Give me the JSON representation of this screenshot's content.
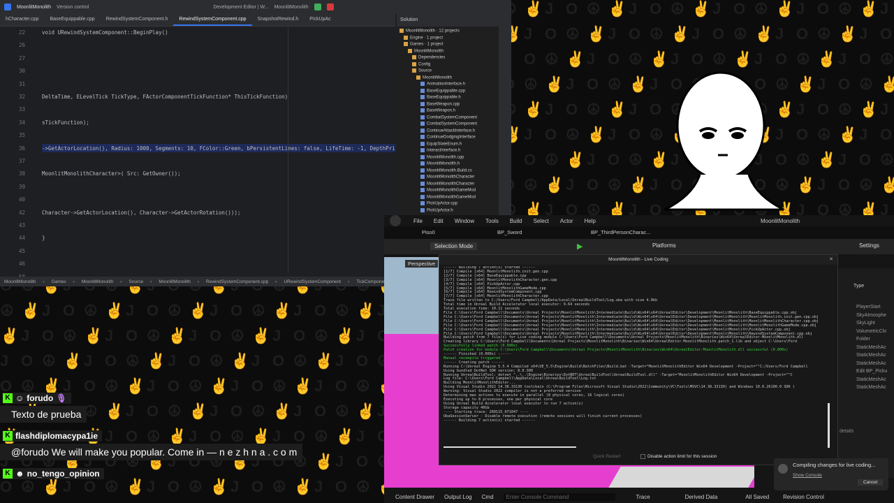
{
  "ide": {
    "project": "MoonlitMonolith",
    "vcs": "Version control",
    "config": "Development Editor | W...",
    "target": "MoonlitMonolith",
    "tabs": [
      "hCharacter.cpp",
      "BaseEquippable.cpp",
      "RewindSystemComponent.h",
      "RewindSystemComponent.cpp",
      "SnapshotRewind.h",
      "PickUpAc"
    ],
    "active_tab": 3,
    "lines": [
      {
        "n": "22",
        "code": "void URewindSystemComponent::BeginPlay()"
      },
      {
        "n": "26",
        "code": ""
      },
      {
        "n": "27",
        "code": ""
      },
      {
        "n": "30",
        "code": ""
      },
      {
        "n": "31",
        "code": ""
      },
      {
        "n": "32",
        "code": "DeltaTime, ELevelTick TickType, FActorComponentTickFunction* ThisTickFunction)"
      },
      {
        "n": "33",
        "code": ""
      },
      {
        "n": "34",
        "code": "sTickFunction);"
      },
      {
        "n": "35",
        "code": ""
      },
      {
        "n": "36",
        "code": "->GetActorLocation(), Radius: 1000, Segments: 10, FColor::Green, bPersistentLines: false, LifeTime: -1, DepthPri"
      },
      {
        "n": "37",
        "code": ""
      },
      {
        "n": "38",
        "code": "MoonlitMonolithCharacter>( Src: GetOwner());"
      },
      {
        "n": "39",
        "code": ""
      },
      {
        "n": "40",
        "code": ""
      },
      {
        "n": "42",
        "code": "Character->GetActorLocation(), Character->GetActorRotation()));"
      },
      {
        "n": "43",
        "code": ""
      },
      {
        "n": "44",
        "code": "}"
      },
      {
        "n": "45",
        "code": ""
      },
      {
        "n": "46",
        "code": ""
      },
      {
        "n": "58",
        "code": ""
      }
    ],
    "breadcrumb": [
      "MoonlitMonolith",
      "Games",
      "MoonlitMonolith",
      "Source",
      "MoonlitMonolith",
      "RewindSystemComponent.cpp",
      "URewindSystemComponent",
      "TickComponent"
    ],
    "solution": {
      "title": "Solution",
      "items": [
        {
          "label": "MoonlitMonolith · 12 projects",
          "indent": 0
        },
        {
          "label": "Engine · 1 project",
          "indent": 1
        },
        {
          "label": "Games · 1 project",
          "indent": 1
        },
        {
          "label": "MoonlitMonolith",
          "indent": 2
        },
        {
          "label": "Dependencies",
          "indent": 3
        },
        {
          "label": "Config",
          "indent": 3
        },
        {
          "label": "Source",
          "indent": 3
        },
        {
          "label": "MoonlitMonolith",
          "indent": 4
        },
        {
          "label": "AnimationInterface.h",
          "indent": 5
        },
        {
          "label": "BaseEquippable.cpp",
          "indent": 5
        },
        {
          "label": "BaseEquippable.h",
          "indent": 5
        },
        {
          "label": "BaseWeapon.cpp",
          "indent": 5
        },
        {
          "label": "BaseWeapon.h",
          "indent": 5
        },
        {
          "label": "CombatSystemComponent",
          "indent": 5
        },
        {
          "label": "CombatSystemComponent",
          "indent": 5
        },
        {
          "label": "ContinueAttackInterface.h",
          "indent": 5
        },
        {
          "label": "ContinueDodgingInterface",
          "indent": 5
        },
        {
          "label": "EquipStateEnum.h",
          "indent": 5
        },
        {
          "label": "InteractInterface.h",
          "indent": 5
        },
        {
          "label": "MoonlitMonolith.cpp",
          "indent": 5
        },
        {
          "label": "MoonlitMonolith.h",
          "indent": 5
        },
        {
          "label": "MoonlitMonolith.Build.cs",
          "indent": 5
        },
        {
          "label": "MoonlitMonolithCharacter",
          "indent": 5
        },
        {
          "label": "MoonlitMonolithCharacter",
          "indent": 5
        },
        {
          "label": "MoonlitMonolithGameMod",
          "indent": 5
        },
        {
          "label": "MoonlitMonolithGameMod",
          "indent": 5
        },
        {
          "label": "PickUpActor.cpp",
          "indent": 5
        },
        {
          "label": "PickUpActor.h",
          "indent": 5
        }
      ]
    }
  },
  "chat": [
    {
      "user": "forudo",
      "msg": "Texto de prueba"
    },
    {
      "user": "flashdiplomacypa1ie",
      "msg": "@forudo We will make you popular. Come in — n e z h n a . c o m"
    },
    {
      "user": "no_tengo_opinion",
      "msg": ""
    }
  ],
  "ue": {
    "menu": [
      "File",
      "Edit",
      "Window",
      "Tools",
      "Build",
      "Select",
      "Actor",
      "Help"
    ],
    "project": "MoonlitMonolith",
    "tabs": [
      "Piso0",
      "BP_Sword",
      "BP_ThirdPersonCharac..."
    ],
    "selection_mode": "Selection Mode",
    "platforms": "Platforms",
    "settings": "Settings",
    "viewport_label": "Perspective",
    "outliner_header": "Type",
    "outliner_items": [
      "PlayerStart",
      "SkyAtmosphe",
      "SkyLight",
      "VolumetricClo",
      "Folder",
      "StaticMeshAc",
      "StaticMeshAc",
      "StaticMeshAc",
      "Edit BP_Picku",
      "StaticMeshAc",
      "StaticMeshAc"
    ],
    "details": "details",
    "bottom": {
      "content_drawer": "Content Drawer",
      "output_log": "Output Log",
      "cmd": "Cmd",
      "console_placeholder": "Enter Console Command",
      "trace": "Trace",
      "derived_data": "Derived Data",
      "all_saved": "All Saved",
      "revision_control": "Revision Control"
    },
    "live_coding": {
      "title": "MoonlitMonolith - Live Coding",
      "log": [
        {
          "t": "------ Building 7 action(s) started ------",
          "g": false
        },
        {
          "t": "[1/7] Compile [x64] MoonlitMonolith.init.gen.cpp",
          "g": false
        },
        {
          "t": "[2/7] Compile [x64] BaseEquippable.cpp",
          "g": false
        },
        {
          "t": "[3/7] Compile [x64] MoonlitMonolithCharacter.gen.cpp",
          "g": false
        },
        {
          "t": "[4/7] Compile [x64] PickUpActor.cpp",
          "g": false
        },
        {
          "t": "[5/7] Compile [x64] MoonlitMonolithGameMode.cpp",
          "g": false
        },
        {
          "t": "[6/7] Compile [x64] RewindSystemComponent.cpp",
          "g": false
        },
        {
          "t": "[7/7] Compile [x64] MoonlitMonolithCharacter.cpp",
          "g": false
        },
        {
          "t": "Trace file written to C:/Users/Ford Campbell/AppData/Local/UnrealBuildTool/Log.uba with size 4.0kb",
          "g": false
        },
        {
          "t": "Total time in Unreal Build Accelerator local executor: 9.64 seconds",
          "g": false
        },
        {
          "t": "Total execution time: 10.11 seconds",
          "g": false
        },
        {
          "t": "File C:\\Users\\Ford Campbell\\Documents\\Unreal Projects\\MoonlitMonolith\\Intermediate\\Build\\Win64\\x64\\UnrealEditor\\Development\\MoonlitMonolith\\BaseEquippable.cpp.obj",
          "g": false
        },
        {
          "t": "File C:\\Users\\Ford Campbell\\Documents\\Unreal Projects\\MoonlitMonolith\\Intermediate\\Build\\Win64\\x64\\UnrealEditor\\Development\\MoonlitMonolith\\MoonlitMonolith.init.gen.cpp.obj",
          "g": false
        },
        {
          "t": "File C:\\Users\\Ford Campbell\\Documents\\Unreal Projects\\MoonlitMonolith\\Intermediate\\Build\\Win64\\x64\\UnrealEditor\\Development\\MoonlitMonolith\\MoonlitMonolithCharacter.cpp.obj",
          "g": false
        },
        {
          "t": "File C:\\Users\\Ford Campbell\\Documents\\Unreal Projects\\MoonlitMonolith\\Intermediate\\Build\\Win64\\x64\\UnrealEditor\\Development\\MoonlitMonolith\\MoonlitMonolithGameMode.cpp.obj",
          "g": false
        },
        {
          "t": "File C:\\Users\\Ford Campbell\\Documents\\Unreal Projects\\MoonlitMonolith\\Intermediate\\Build\\Win64\\x64\\UnrealEditor\\Development\\MoonlitMonolith\\PickUpActor.cpp.obj",
          "g": false
        },
        {
          "t": "File C:\\Users\\Ford Campbell\\Documents\\Unreal Projects\\MoonlitMonolith\\Intermediate\\Build\\Win64\\x64\\UnrealEditor\\Development\\MoonlitMonolith\\RewindSystemComponent.cpp.obj",
          "g": false
        },
        {
          "t": "Building patch from 7 file(s) for Live coding module C:\\Users\\Ford Campbell\\Documents\\Unreal Projects\\MoonlitMonolith\\Binaries\\Win64\\UnrealEditor-MoonlitMonolith.dll",
          "g": false
        },
        {
          "t": "  Creating library C:\\Users\\Ford Campbell\\Documents\\Unreal Projects\\MoonlitMonolith\\Binaries\\Win64\\UnrealEditor-MoonlitMonolith.patch_1.lib and object C:\\Users\\Ford",
          "g": false
        },
        {
          "t": "Successfully linked patch (0.000s)",
          "g": true
        },
        {
          "t": "Patch creation for module C:\\Users\\Ford Campbell\\Documents\\Unreal Projects\\MoonlitMonolith\\Binaries\\Win64\\UnrealEditor-MoonlitMonolith.dll successful (0.000s)",
          "g": true
        },
        {
          "t": "------ Finished (0.000s) ------",
          "g": false
        },
        {
          "t": "Manual recompile triggered",
          "g": true
        },
        {
          "t": "------ Creating patch ------",
          "g": false
        },
        {
          "t": "Running C:\\Unreal Engine 5.5.4 Compiled x64\\UE_5.5\\Engine\\Build\\BatchFiles\\Build.bat -Target=\"MoonlitMonolithEditor Win64 Development -Project=\"\"C:/Users/Ford Campbell",
          "g": false
        },
        {
          "t": "  Using bundled DotNet SDK version: 8.0.300",
          "g": false
        },
        {
          "t": "  Running UnrealBuildTool: dotnet \"..\\..\\Engine\\Binaries\\DotNET\\UnrealBuildTool\\UnrealBuildTool.dll\" -Target=\"MoonlitMonolithEditor Win64 Development -Project=\"\"C",
          "g": false
        },
        {
          "t": "  Log file: C:\\Users\\Ford Campbell\\AppData\\Local\\UnrealBuildTool\\Log.txt",
          "g": false
        },
        {
          "t": "  Building MoonlitMonolithEditor...",
          "g": false
        },
        {
          "t": "  Using Visual Studio 2022 14.38.33130 toolchain (C:\\Program Files\\Microsoft Visual Studio\\2022\\Community\\VC\\Tools\\MSVC\\14.38.33130) and Windows 10.0.26100.0 SDK (",
          "g": false
        },
        {
          "t": "  Warning: Visual Studio 2022 compiler is not a preferred version",
          "g": false
        },
        {
          "t": "  Determining max actions to execute in parallel (8 physical cores, 16 logical cores)",
          "g": false
        },
        {
          "t": "    Executing up to 8 processes, one per physical core",
          "g": false
        },
        {
          "t": "  Using Unreal Build Accelerator local executor to run 7 action(s)",
          "g": false
        },
        {
          "t": "    Storage capacity 40Gb",
          "g": false
        },
        {
          "t": "  ---- Starting trace: 260115_071047 ----",
          "g": false
        },
        {
          "t": "  UbaSessionServer - Disable remote execution (remote sessions will finish current processes)",
          "g": false
        },
        {
          "t": "------ Building 7 action(s) started ------",
          "g": false
        }
      ],
      "quick_restart": "Quick Restart",
      "disable_limit": "Disable action limit for this session"
    },
    "notification": {
      "text": "Compiling changes for live coding...",
      "show_console": "Show Console",
      "cancel": "Cancel"
    }
  }
}
